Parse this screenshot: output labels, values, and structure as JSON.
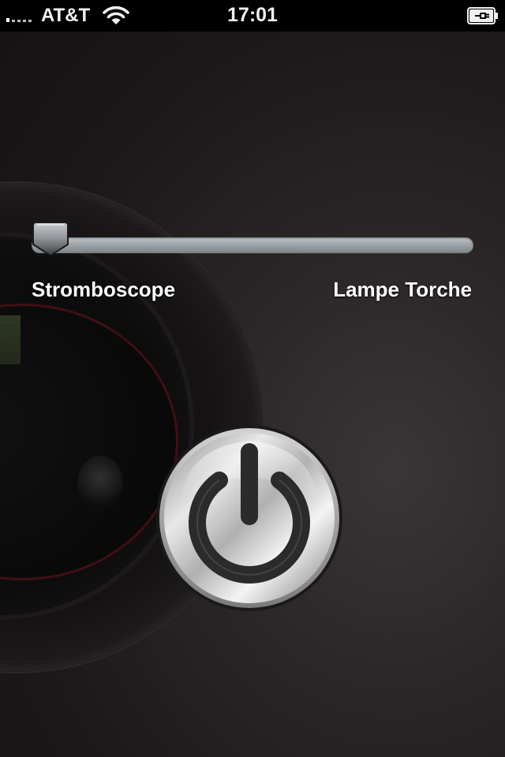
{
  "status_bar": {
    "carrier": "AT&T",
    "time": "17:01",
    "signal_bars": 1,
    "signal_icon": "signal-bars-icon",
    "wifi_icon": "wifi-icon",
    "battery_icon": "battery-charging-icon"
  },
  "slider": {
    "value": 0,
    "left_label": "Stromboscope",
    "right_label": "Lampe Torche",
    "thumb_icon": "slider-thumb-icon"
  },
  "power_button": {
    "icon": "power-icon"
  },
  "colors": {
    "background": "#1b1819",
    "status_bar": "#000000",
    "text": "#ffffff",
    "slider_track": "#9ea4a8"
  }
}
